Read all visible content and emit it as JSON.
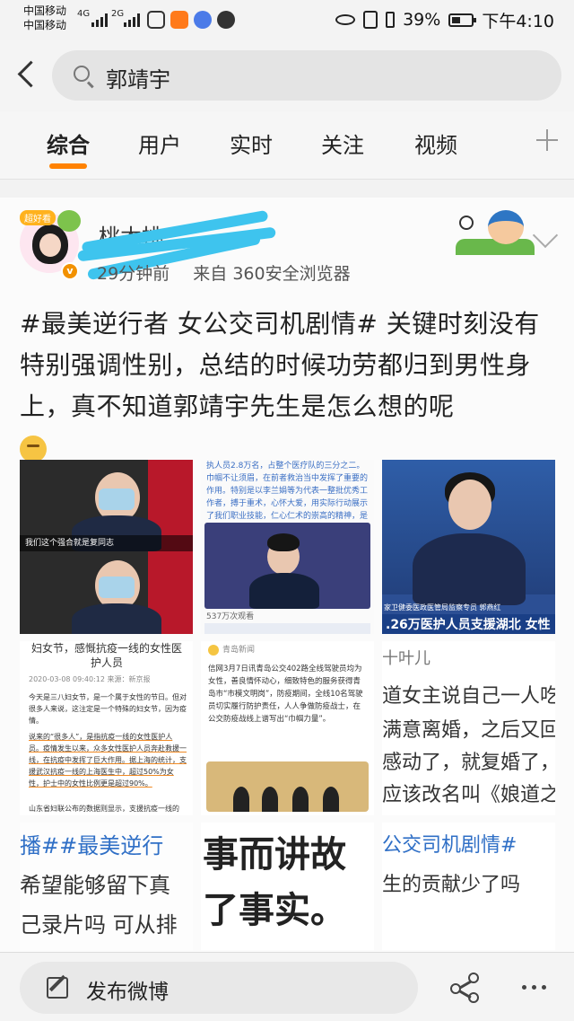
{
  "status_bar": {
    "carrier_1": "中国移动",
    "carrier_2": "中国移动",
    "net_1": "4G",
    "net_2": "2G",
    "battery": "39%",
    "time": "下午4:10"
  },
  "search": {
    "back_icon": "chevron-left-icon",
    "search_icon": "search-icon",
    "query": "郭靖宇"
  },
  "tabs": {
    "items": [
      {
        "label": "综合",
        "active": true
      },
      {
        "label": "用户",
        "active": false
      },
      {
        "label": "实时",
        "active": false
      },
      {
        "label": "关注",
        "active": false
      },
      {
        "label": "视频",
        "active": false
      }
    ],
    "add_icon": "plus-icon"
  },
  "post": {
    "avatar_tag": "超好看",
    "username": "桃木桃",
    "time_ago": "29分钟前",
    "source": "来自 360安全浏览器",
    "text": "#最美逆行者 女公交司机剧情# 关键时刻没有特别强调性别，总结的时候功劳都归到男性身上，真不知道郭靖宇先生是怎么想的呢",
    "emoji_icon": "thinking-emoji-icon",
    "more_icon": "chevron-down-icon"
  },
  "images": {
    "c1_caption": "我们这个强合就是复同志",
    "c2_top": "执人员2.8万名，占整个医疗队的三分之二。巾帼不让须眉，在前者救治当中发挥了重要的作用。特别是以李兰娟等为代表一整批优秀工作者，搏于重术，心怀大爱，用实际行动展示了我们职业技能，仁心仁术的崇高的精神，是这个时代国可爱的人！",
    "c2_video_title": "537万次观看",
    "c3_bar": ".26万医护人员支援湖北 女性",
    "c3_label": "家卫健委医政医管局监察专员 郭燕红",
    "c4_title_1": "妇女节，感慨抗疫一线的女性医",
    "c4_title_2": "护人员",
    "c4_date": "2020-03-08 09:40:12   来源：新京报",
    "c4_p1": "今天是三八妇女节，是一个属于女性的节日。但对很多人来说，这注定是一个特殊的妇女节，因为疫情。",
    "c4_p2": "说来的“很多人”，是指抗疫一线的女性医护人员。疫情发生以来，众多女性医护人员奔赴救援一线，在抗疫中发挥了巨大作用。据上海的统计，支援武汉抗疫一线的上海医生中，超过50%为女性，护士中的女性比例更是超过90%。",
    "c4_p3": "山东省妇联公布的数据则显示，支援抗疫一线的",
    "c5_account": "青岛新闻",
    "c5_text": "信网3月7日讯青岛公交402路全线驾驶员均为女性，善良情怀动心，细致特色的服务获得青岛市“市模文明岗”，防疫期间，全线10名驾驶员切实履行防护责任，人人争做防疫战士，在公交防疫战线上谱写出“巾帼力量”。",
    "c6_line_1": "十叶儿",
    "c6_line_2": "道女主说自己一人吃",
    "c6_line_3": "满意离婚，之后又回",
    "c6_line_4": "感动了，就复婚了，",
    "c6_line_5": "应该改名叫《娘道之",
    "c7_line_1": "播##最美逆行",
    "c7_line_2": "希望能够留下真",
    "c7_line_3": "己录片吗 可从排",
    "c8_line_1": "事而讲故",
    "c8_line_2": "了事实。",
    "c9_line_1": "公交司机剧情#",
    "c9_line_2": "生的贡献少了吗"
  },
  "bottom_bar": {
    "compose_icon": "edit-icon",
    "compose_label": "发布微博",
    "share_icon": "share-icon",
    "more_icon": "more-dots-icon"
  },
  "colors": {
    "accent": "#ff8200",
    "verified": "#f29100",
    "link_blue": "#3b6fc4"
  }
}
